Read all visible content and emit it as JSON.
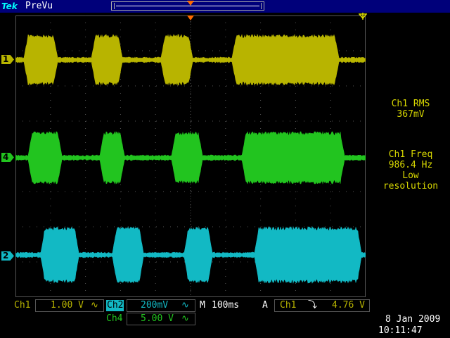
{
  "header": {
    "logo": "Tek",
    "mode": "PreVu"
  },
  "channels": [
    {
      "id": "1",
      "label": "1",
      "color": "#b8b400",
      "scale": "1.00 V"
    },
    {
      "id": "4",
      "label": "4",
      "color": "#22c41f",
      "scale": "5.00 V"
    },
    {
      "id": "2",
      "label": "2",
      "color": "#12b9c4",
      "scale": "200mV"
    }
  ],
  "measurements": [
    {
      "name": "Ch1 RMS",
      "value": "367mV"
    },
    {
      "name": "Ch1 Freq",
      "value": "986.4 Hz",
      "note1": "Low",
      "note2": "resolution"
    }
  ],
  "status": {
    "ch1_label": "Ch1",
    "ch1_scale": "1.00 V",
    "ch1_coupling": "∿",
    "ch2_label": "Ch2",
    "ch2_scale": "200mV",
    "ch2_coupling": "∿",
    "timebase_label": "M",
    "timebase": "100ms",
    "trigger_label": "A",
    "trigger_source": "Ch1",
    "trigger_slope": "⤵",
    "trigger_level": "4.76 V",
    "ch4_label": "Ch4",
    "ch4_scale": "5.00 V",
    "ch4_coupling": "∿",
    "date": "8 Jan  2009",
    "time": "10:11:47"
  },
  "colors": {
    "grid": "#555555",
    "trigger": "#ff6a00",
    "background": "#000000"
  }
}
